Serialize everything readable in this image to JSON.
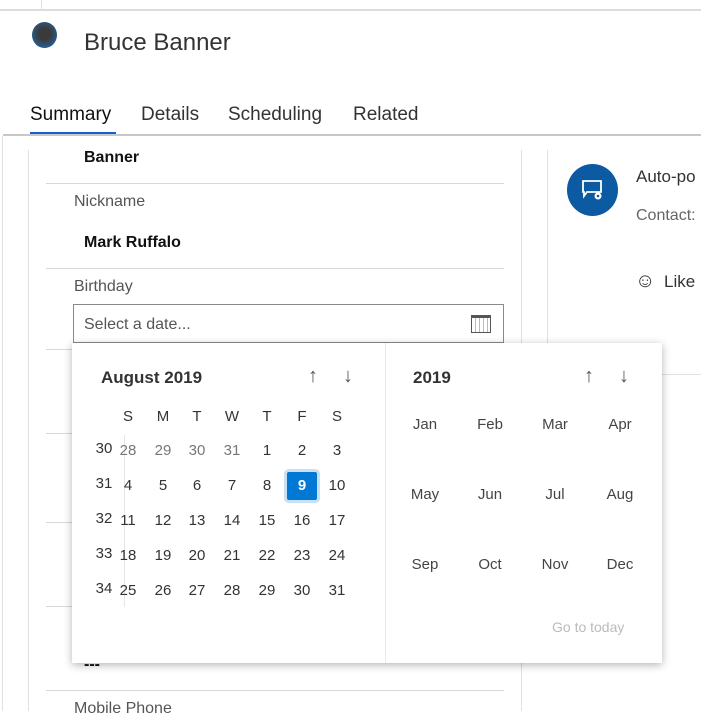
{
  "header": {
    "name": "Bruce Banner"
  },
  "tabs": [
    {
      "label": "Summary",
      "active": true
    },
    {
      "label": "Details"
    },
    {
      "label": "Scheduling"
    },
    {
      "label": "Related"
    }
  ],
  "form": {
    "last_name_value": "Banner",
    "nickname_label": "Nickname",
    "nickname_value": "Mark Ruffalo",
    "birthday_label": "Birthday",
    "birthday_placeholder": "Select a date...",
    "hidden_value": "---",
    "mobile_phone_label": "Mobile Phone"
  },
  "timeline": {
    "post_title": "Auto-po",
    "post_contact": "Contact:",
    "like_label": "Like"
  },
  "datepicker": {
    "month_title": "August 2019",
    "year_title": "2019",
    "weekdays": [
      "S",
      "M",
      "T",
      "W",
      "T",
      "F",
      "S"
    ],
    "weeks": [
      {
        "week": "30",
        "days": [
          "28",
          "29",
          "30",
          "31",
          "1",
          "2",
          "3"
        ]
      },
      {
        "week": "31",
        "days": [
          "4",
          "5",
          "6",
          "7",
          "8",
          "9",
          "10"
        ]
      },
      {
        "week": "32",
        "days": [
          "11",
          "12",
          "13",
          "14",
          "15",
          "16",
          "17"
        ]
      },
      {
        "week": "33",
        "days": [
          "18",
          "19",
          "20",
          "21",
          "22",
          "23",
          "24"
        ]
      },
      {
        "week": "34",
        "days": [
          "25",
          "26",
          "27",
          "28",
          "29",
          "30",
          "31"
        ]
      }
    ],
    "selected_day": "9",
    "months": [
      "Jan",
      "Feb",
      "Mar",
      "Apr",
      "May",
      "Jun",
      "Jul",
      "Aug",
      "Sep",
      "Oct",
      "Nov",
      "Dec"
    ],
    "go_to_today": "Go to today",
    "accent": "#0078d4"
  }
}
